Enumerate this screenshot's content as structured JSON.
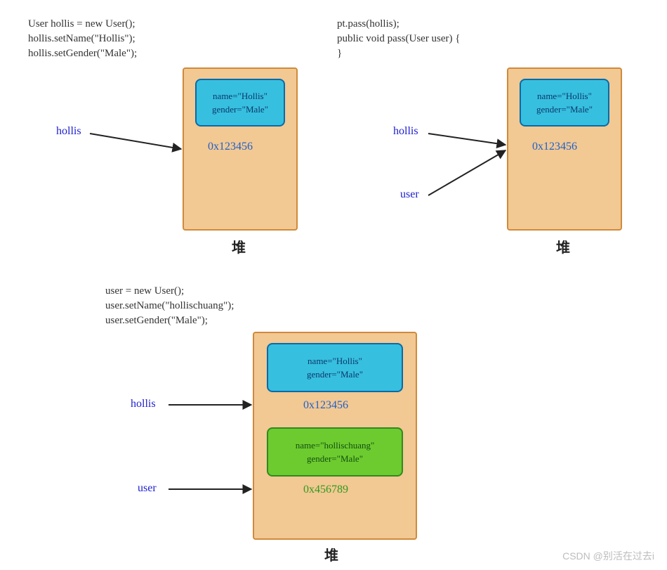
{
  "panel1": {
    "code": "User hollis = new User();\nhollis.setName(\"Hollis\");\nhollis.setGender(\"Male\");",
    "ref1": "hollis",
    "obj1_text": "name=\"Hollis\"\ngender=\"Male\"",
    "addr1": "0x123456",
    "heap_label": "堆"
  },
  "panel2": {
    "code": "pt.pass(hollis);\npublic void pass(User user) {\n}",
    "ref1": "hollis",
    "ref2": "user",
    "obj1_text": "name=\"Hollis\"\ngender=\"Male\"",
    "addr1": "0x123456",
    "heap_label": "堆"
  },
  "panel3": {
    "code": "user = new User();\nuser.setName(\"hollischuang\");\nuser.setGender(\"Male\");",
    "ref1": "hollis",
    "ref2": "user",
    "obj1_text": "name=\"Hollis\"\ngender=\"Male\"",
    "addr1": "0x123456",
    "obj2_text": "name=\"hollischuang\"\ngender=\"Male\"",
    "addr2": "0x456789",
    "heap_label": "堆"
  },
  "watermark": "CSDN @别活在过去i"
}
